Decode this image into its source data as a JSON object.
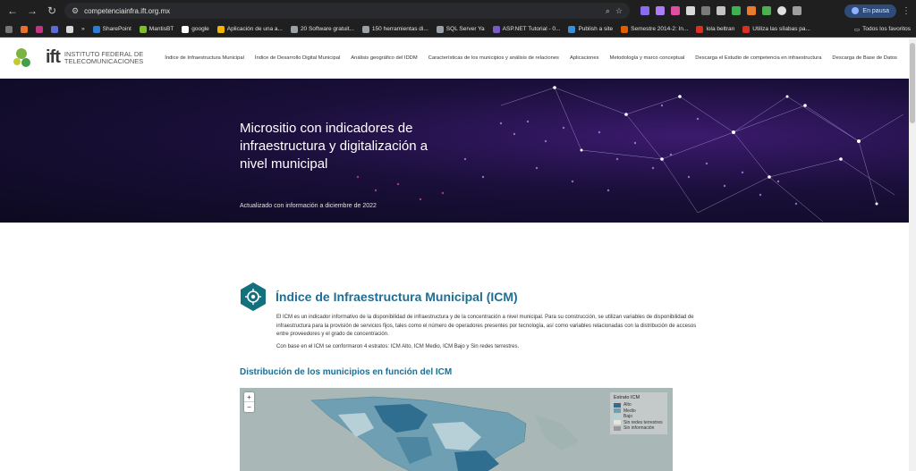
{
  "browser": {
    "url": "competenciainfra.ift.org.mx",
    "profile_pill": "En pausa",
    "bookmarks": [
      "SharePoint",
      "MantisBT",
      "google",
      "Aplicación de una a...",
      "20 Software gratuit...",
      "150 herramientas di...",
      "SQL Server Ya",
      "ASP.NET Tutorial - 0...",
      "Publish a site",
      "Semestre 2014-2: In...",
      "lola beltran",
      "Utiliza las sílabas pa..."
    ],
    "all_bookmarks": "Todos los favoritos"
  },
  "header": {
    "logo_text": "ift",
    "logo_sub1": "INSTITUTO FEDERAL DE",
    "logo_sub2": "TELECOMUNICACIONES",
    "nav": [
      "Índice de Infraestructura Municipal",
      "Índice de Desarrollo Digital Municipal",
      "Análisis geográfico del IDDM",
      "Características de los municipios y análisis de relaciones",
      "Aplicaciones",
      "Metodología y marco conceptual",
      "Descarga el Estudio de competencia en infraestructura",
      "Descarga de Base de Datos"
    ]
  },
  "hero": {
    "title": "Micrositio con indicadores de infraestructura y digitalización a nivel municipal",
    "updated": "Actualizado con información a diciembre de 2022"
  },
  "icm": {
    "title": "Índice de Infraestructura Municipal (ICM)",
    "description": "El ICM es un indicador informativo de la disponibilidad de infraestructura y de la concentración a nivel municipal. Para su construcción, se utilizan variables de disponibilidad de infraestructura para la provisión de servicios fijos, tales como el número de operadores presentes por tecnología, así como variables relacionadas con la distribución de accesos entre proveedores y el grado de concentración.",
    "strata": "Con base en el ICM se conformaron 4 estratos: ICM Alto, ICM Medio, ICM Bajo y Sin redes terrestres.",
    "distribution_title": "Distribución de los municipios en función del ICM"
  },
  "map": {
    "zoom_in": "+",
    "zoom_out": "−",
    "legend_title": "Estrato ICM",
    "legend": [
      {
        "label": "Alto",
        "color": "#2f6e8e"
      },
      {
        "label": "Medio",
        "color": "#6f9fb3"
      },
      {
        "label": "Bajo",
        "color": "#b7d0d8"
      },
      {
        "label": "Sin redes terrestres",
        "color": "#e3e6d8"
      },
      {
        "label": "Sin información",
        "color": "#9a9a9a"
      }
    ]
  }
}
